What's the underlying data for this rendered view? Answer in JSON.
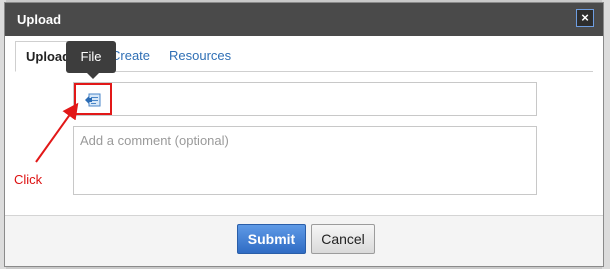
{
  "dialog": {
    "title": "Upload",
    "close_symbol": "×"
  },
  "tabs": [
    {
      "label": "Upload",
      "active": true
    },
    {
      "label": "Create",
      "active": false
    },
    {
      "label": "Resources",
      "active": false
    }
  ],
  "tooltip": {
    "text": "File"
  },
  "file_button": {
    "icon": "file-upload-icon"
  },
  "comment": {
    "placeholder": "Add a comment (optional)"
  },
  "annotation": {
    "label": "Click",
    "color": "#e21818"
  },
  "footer": {
    "submit_label": "Submit",
    "cancel_label": "Cancel"
  },
  "colors": {
    "titlebar": "#4a4a4a",
    "tab_link": "#2f6fb5",
    "submit": "#3a78d0"
  }
}
